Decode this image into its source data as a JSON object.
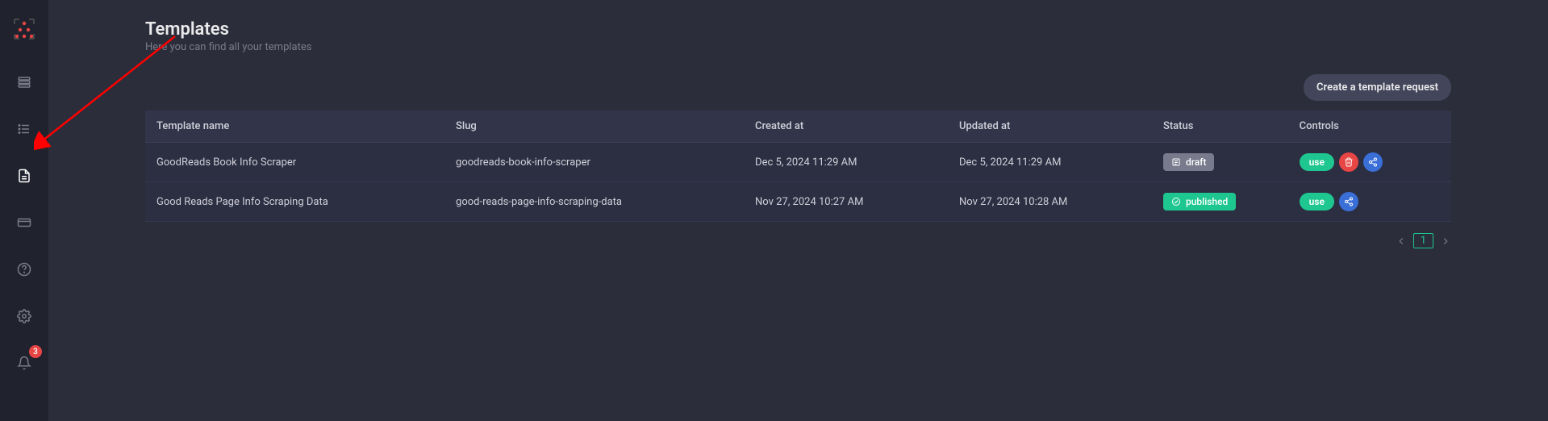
{
  "header": {
    "title": "Templates",
    "subtitle": "Here you can find all your templates"
  },
  "actions": {
    "create_template_request": "Create a template request"
  },
  "table": {
    "columns": {
      "name": "Template name",
      "slug": "Slug",
      "created": "Created at",
      "updated": "Updated at",
      "status": "Status",
      "controls": "Controls"
    },
    "rows": [
      {
        "name": "GoodReads Book Info Scraper",
        "slug": "goodreads-book-info-scraper",
        "created": "Dec 5, 2024 11:29 AM",
        "updated": "Dec 5, 2024 11:29 AM",
        "status": "draft",
        "status_label": "draft",
        "use_label": "use",
        "has_delete": true
      },
      {
        "name": "Good Reads Page Info Scraping Data",
        "slug": "good-reads-page-info-scraping-data",
        "created": "Nov 27, 2024 10:27 AM",
        "updated": "Nov 27, 2024 10:28 AM",
        "status": "published",
        "status_label": "published",
        "use_label": "use",
        "has_delete": false
      }
    ]
  },
  "pagination": {
    "current": "1"
  },
  "notifications": {
    "count": "3"
  },
  "colors": {
    "accent_green": "#1ec78f",
    "accent_red": "#e84545",
    "accent_blue": "#3a6fd8",
    "bg": "#2b2d3a",
    "sidebar": "#20222e"
  }
}
